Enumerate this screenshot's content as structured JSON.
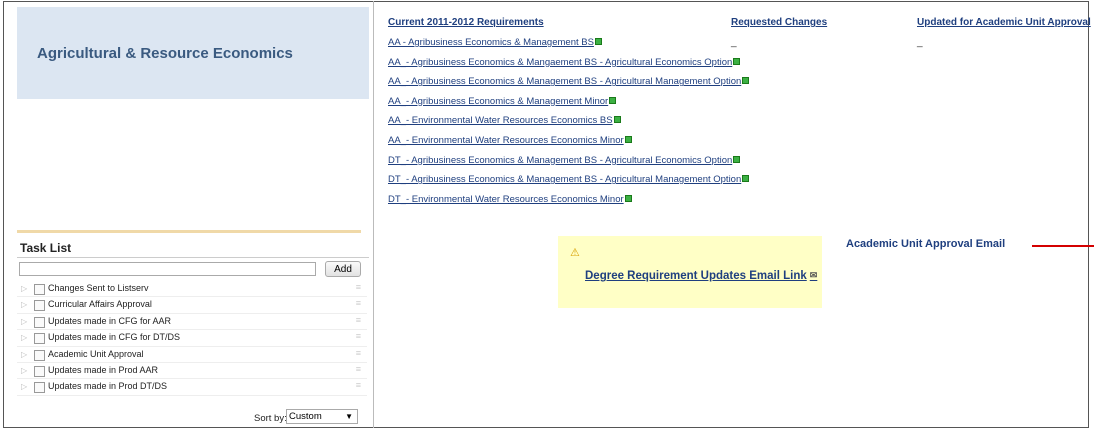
{
  "department": {
    "title": "Agricultural & Resource Economics"
  },
  "columns": {
    "current": "Current 2011-2012 Requirements",
    "requested": "Requested Changes",
    "updated": "Updated for Academic Unit Approval",
    "requested_value": "_",
    "updated_value": "_"
  },
  "requirements": [
    "AA - Agribusiness Economics & Management BS",
    "AA_- Agribusiness Economics & Mangaement BS - Agricultural Economics Option",
    "AA_- Agribusiness Economics & Management BS - Agricultural Management Option",
    "AA_- Agribusiness Economics & Management Minor",
    "AA_- Environmental Water Resources Economics BS",
    "AA_- Environmental Water Resources Economics Minor",
    "DT_- Agribusiness Economics & Management BS - Agricultural Economics Option",
    "DT_- Agribusiness Economics & Management BS - Agricultural Management Option",
    "DT_- Environmental Water Resources Economics Minor"
  ],
  "task_list": {
    "title": "Task List",
    "add_label": "Add",
    "items": [
      "Changes Sent to Listserv",
      "Curricular Affairs Approval",
      "Updates made in CFG for AAR",
      "Updates made in CFG for DT/DS",
      "Academic Unit Approval",
      "Updates made in Prod AAR",
      "Updates made in Prod DT/DS"
    ],
    "sort_label": "Sort by:",
    "sort_value": "Custom"
  },
  "email": {
    "link_text": "Degree Requirement Updates Email Link",
    "approval_label": "Academic Unit Approval Email"
  },
  "icons": {
    "warning": "warning-icon",
    "mail": "mail-icon",
    "external": "external-link-icon"
  },
  "colors": {
    "link": "#1f3f7f",
    "header_bg": "#dce6f2",
    "note_bg": "#ffffc6",
    "pointer_line": "#d40000"
  }
}
